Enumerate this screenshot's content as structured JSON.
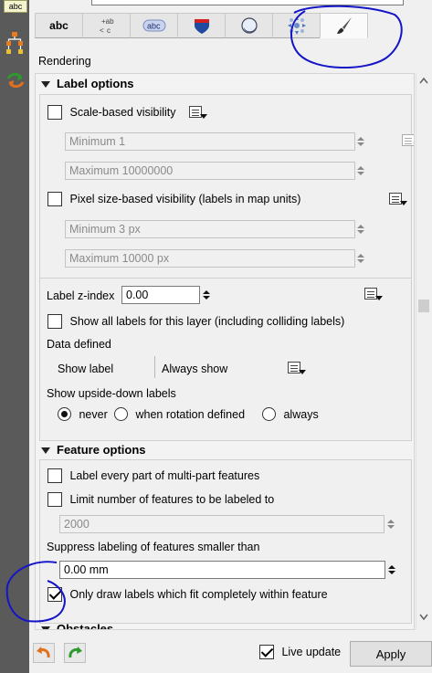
{
  "sidebar": {
    "badge": "abc"
  },
  "tabs": [
    {
      "label": "abc",
      "icon": "text-tab-icon"
    },
    {
      "label": "+ab\n<c",
      "icon": "formatting-tab-icon"
    },
    {
      "label": "abc",
      "icon": "buffer-tab-icon"
    },
    {
      "label": "",
      "icon": "background-shield-icon"
    },
    {
      "label": "",
      "icon": "shadow-icon"
    },
    {
      "label": "",
      "icon": "placement-icon"
    },
    {
      "label": "",
      "icon": "rendering-brush-icon"
    }
  ],
  "section_title": "Rendering",
  "label_options": {
    "title": "Label options",
    "scale_based": "Scale-based visibility",
    "min_scale": "Minimum 1",
    "max_scale": "Maximum 10000000",
    "pixel_based": "Pixel size-based visibility (labels in map units)",
    "min_px": "Minimum 3 px",
    "max_px": "Maximum 10000 px",
    "z_index_label": "Label z-index",
    "z_index_value": "0.00",
    "show_all": "Show all labels for this layer (including colliding labels)",
    "data_defined": "Data defined",
    "show_label": "Show label",
    "always_show": "Always show",
    "upside_down": "Show upside-down labels",
    "radio_never": "never",
    "radio_rotation": "when rotation defined",
    "radio_always": "always"
  },
  "feature_options": {
    "title": "Feature options",
    "every_part": "Label every part of multi-part features",
    "limit_number": "Limit number of features to be labeled to",
    "limit_value": "2000",
    "suppress": "Suppress labeling of features smaller than",
    "suppress_value": "0.00 mm",
    "only_fit": "Only draw labels which fit completely within feature",
    "only_fit_checked": true
  },
  "obstacles_title": "Obstacles",
  "bottom": {
    "live_update": "Live update",
    "live_update_checked": true,
    "apply": "Apply"
  },
  "colors": {
    "annotation": "#1515c8",
    "panel": "#f3f3f3"
  }
}
